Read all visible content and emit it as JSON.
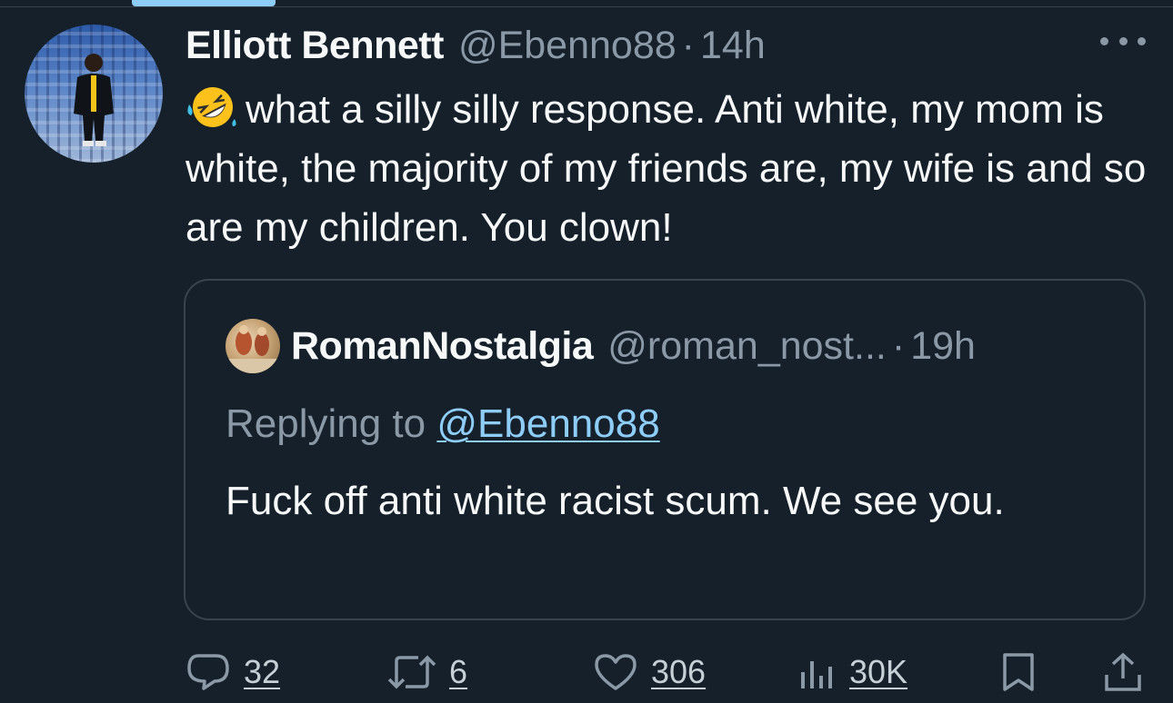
{
  "tweet": {
    "author_name": "Elliott Bennett",
    "author_handle": "@Ebenno88",
    "separator": "·",
    "time": "14h",
    "emoji_icon": "rolling-on-floor-laughing-emoji",
    "text": "what a silly silly response. Anti white, my mom is white, the majority of my friends are, my wife is and so are my children. You clown!"
  },
  "quote": {
    "author_name": "RomanNostalgia",
    "author_handle": "@roman_nost...",
    "separator": "·",
    "time": "19h",
    "replying_prefix": "Replying to ",
    "replying_handle": "@Ebenno88",
    "text": "Fuck off anti white racist scum. We see you."
  },
  "actions": {
    "replies": "32",
    "reposts": "6",
    "likes": "306",
    "views": "30K"
  },
  "colors": {
    "background": "#15202b",
    "text": "#f7f9f9",
    "secondary": "#8b98a5",
    "link": "#8ecdf8",
    "border": "#38444d"
  }
}
